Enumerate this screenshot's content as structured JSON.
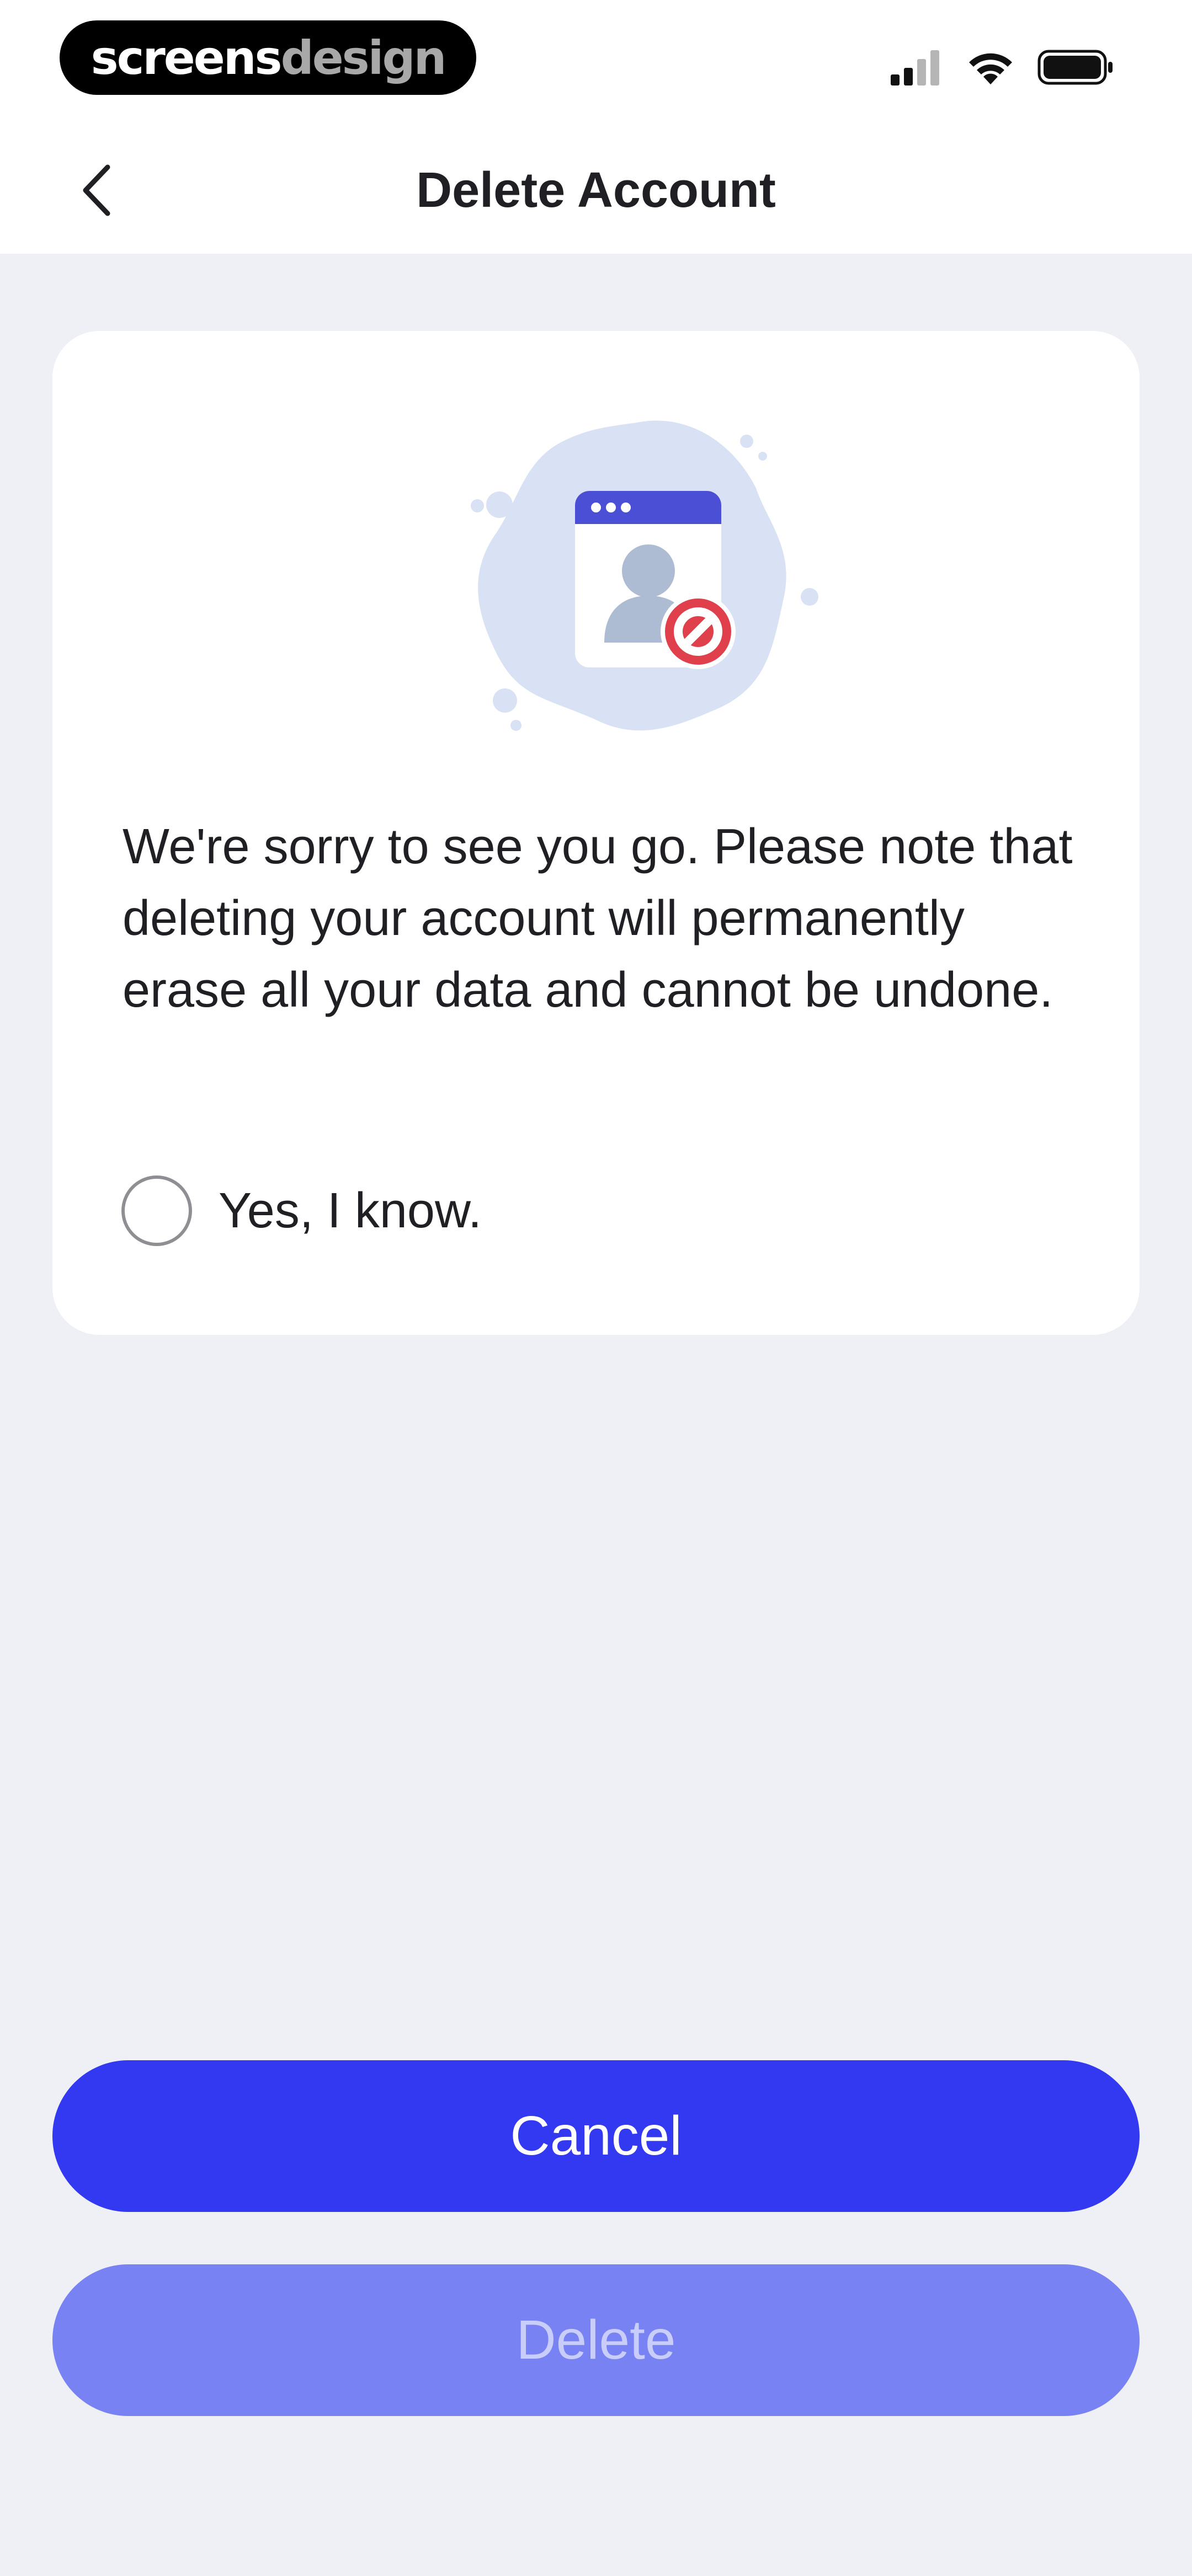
{
  "status_bar": {
    "brand_primary": "screens",
    "brand_secondary": "design"
  },
  "header": {
    "back_icon": "chevron-left-icon",
    "title": "Delete Account"
  },
  "card": {
    "illustration_icon": "blocked-user-icon",
    "notice": "We're sorry to see you go. Please note that deleting your account will permanently erase all your data and cannot be undone.",
    "confirm_label": "Yes, I know.",
    "confirm_checked": false
  },
  "actions": {
    "cancel_label": "Cancel",
    "delete_label": "Delete",
    "delete_enabled": false
  },
  "colors": {
    "accent": "#3239f0",
    "accent_disabled": "#7882f2",
    "background": "#eef0f5",
    "danger": "#e0404c"
  }
}
